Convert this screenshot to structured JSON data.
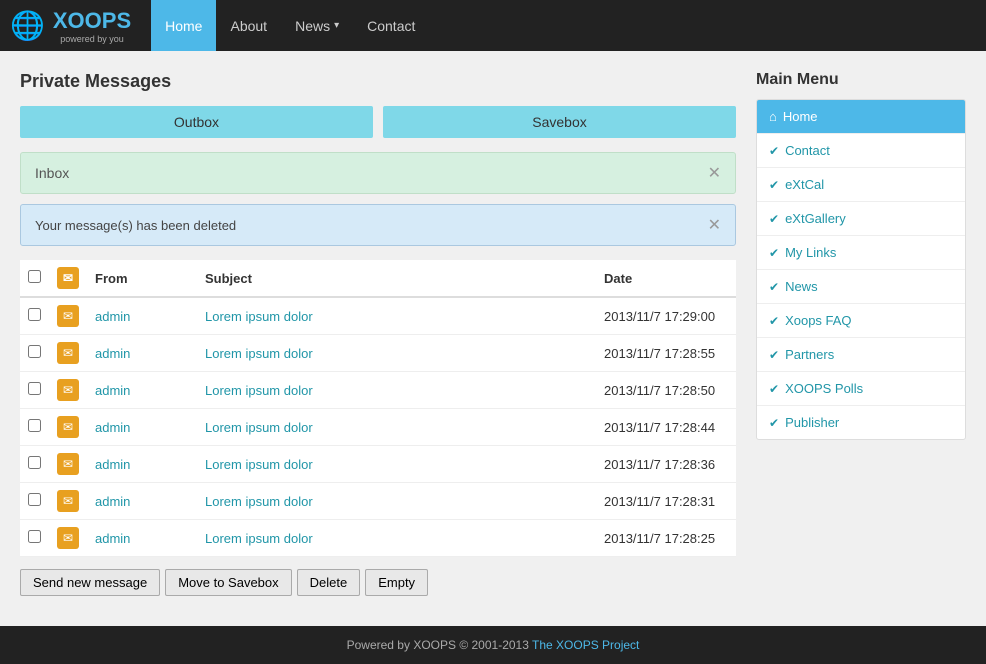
{
  "navbar": {
    "brand_name": "XOOPS",
    "brand_sub": "powered by you",
    "items": [
      {
        "label": "Home",
        "active": true,
        "has_arrow": false
      },
      {
        "label": "About",
        "active": false,
        "has_arrow": false
      },
      {
        "label": "News",
        "active": false,
        "has_arrow": true
      },
      {
        "label": "Contact",
        "active": false,
        "has_arrow": false
      }
    ]
  },
  "main": {
    "page_title": "Private Messages",
    "outbox_label": "Outbox",
    "savebox_label": "Savebox",
    "inbox_label": "Inbox",
    "alert_message": "Your message(s) has been deleted",
    "table": {
      "col_from": "From",
      "col_subject": "Subject",
      "col_date": "Date",
      "rows": [
        {
          "from": "admin",
          "subject": "Lorem ipsum dolor",
          "date": "2013/11/7 17:29:00"
        },
        {
          "from": "admin",
          "subject": "Lorem ipsum dolor",
          "date": "2013/11/7 17:28:55"
        },
        {
          "from": "admin",
          "subject": "Lorem ipsum dolor",
          "date": "2013/11/7 17:28:50"
        },
        {
          "from": "admin",
          "subject": "Lorem ipsum dolor",
          "date": "2013/11/7 17:28:44"
        },
        {
          "from": "admin",
          "subject": "Lorem ipsum dolor",
          "date": "2013/11/7 17:28:36"
        },
        {
          "from": "admin",
          "subject": "Lorem ipsum dolor",
          "date": "2013/11/7 17:28:31"
        },
        {
          "from": "admin",
          "subject": "Lorem ipsum dolor",
          "date": "2013/11/7 17:28:25"
        }
      ]
    },
    "action_buttons": {
      "send": "Send new message",
      "move": "Move to Savebox",
      "delete": "Delete",
      "empty": "Empty"
    }
  },
  "sidebar": {
    "title": "Main Menu",
    "items": [
      {
        "label": "Home",
        "active": true,
        "icon": "home"
      },
      {
        "label": "Contact",
        "active": false,
        "icon": "check"
      },
      {
        "label": "eXtCal",
        "active": false,
        "icon": "check"
      },
      {
        "label": "eXtGallery",
        "active": false,
        "icon": "check"
      },
      {
        "label": "My Links",
        "active": false,
        "icon": "check"
      },
      {
        "label": "News",
        "active": false,
        "icon": "check"
      },
      {
        "label": "Xoops FAQ",
        "active": false,
        "icon": "check"
      },
      {
        "label": "Partners",
        "active": false,
        "icon": "check"
      },
      {
        "label": "XOOPS Polls",
        "active": false,
        "icon": "check"
      },
      {
        "label": "Publisher",
        "active": false,
        "icon": "check"
      }
    ]
  },
  "footer": {
    "text": "Powered by XOOPS © 2001-2013 ",
    "link_text": "The XOOPS Project",
    "link_url": "#"
  }
}
